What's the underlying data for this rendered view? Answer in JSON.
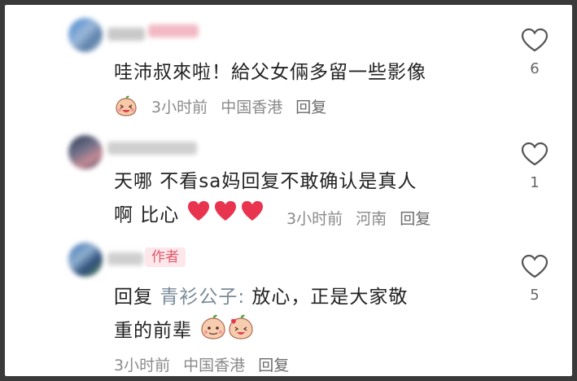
{
  "comments": [
    {
      "text": "哇沛叔來啦！給父女倆多留一些影像",
      "meta": {
        "time": "3小时前",
        "location": "中国香港",
        "reply": "回复"
      },
      "likes": "6",
      "icons": {
        "reaction": "laughing-peach-emoji",
        "like": "heart-outline-icon"
      }
    },
    {
      "text_line1": "天哪  不看sa妈回复不敢确认是真人",
      "text_line2": "啊  比心",
      "meta": {
        "time": "3小时前",
        "location": "河南",
        "reply": "回复"
      },
      "likes": "1",
      "icons": {
        "hearts": "red-heart-emoji",
        "like": "heart-outline-icon"
      }
    },
    {
      "author_tag": "作者",
      "reply_prefix": "回复",
      "reply_to": "青衫公子:",
      "text_line1": "放心，正是大家敬",
      "text_line2": "重的前辈",
      "meta": {
        "time": "3小时前",
        "location": "中国香港",
        "reply": "回复"
      },
      "likes": "5",
      "icons": {
        "emojis": "peach-face-emojis",
        "like": "heart-outline-icon"
      }
    }
  ],
  "colors": {
    "author_tag_bg": "#fde7ea",
    "author_tag_text": "#e05a6b",
    "heart_red": "#e8344e",
    "meta_gray": "#8a8a8a"
  }
}
